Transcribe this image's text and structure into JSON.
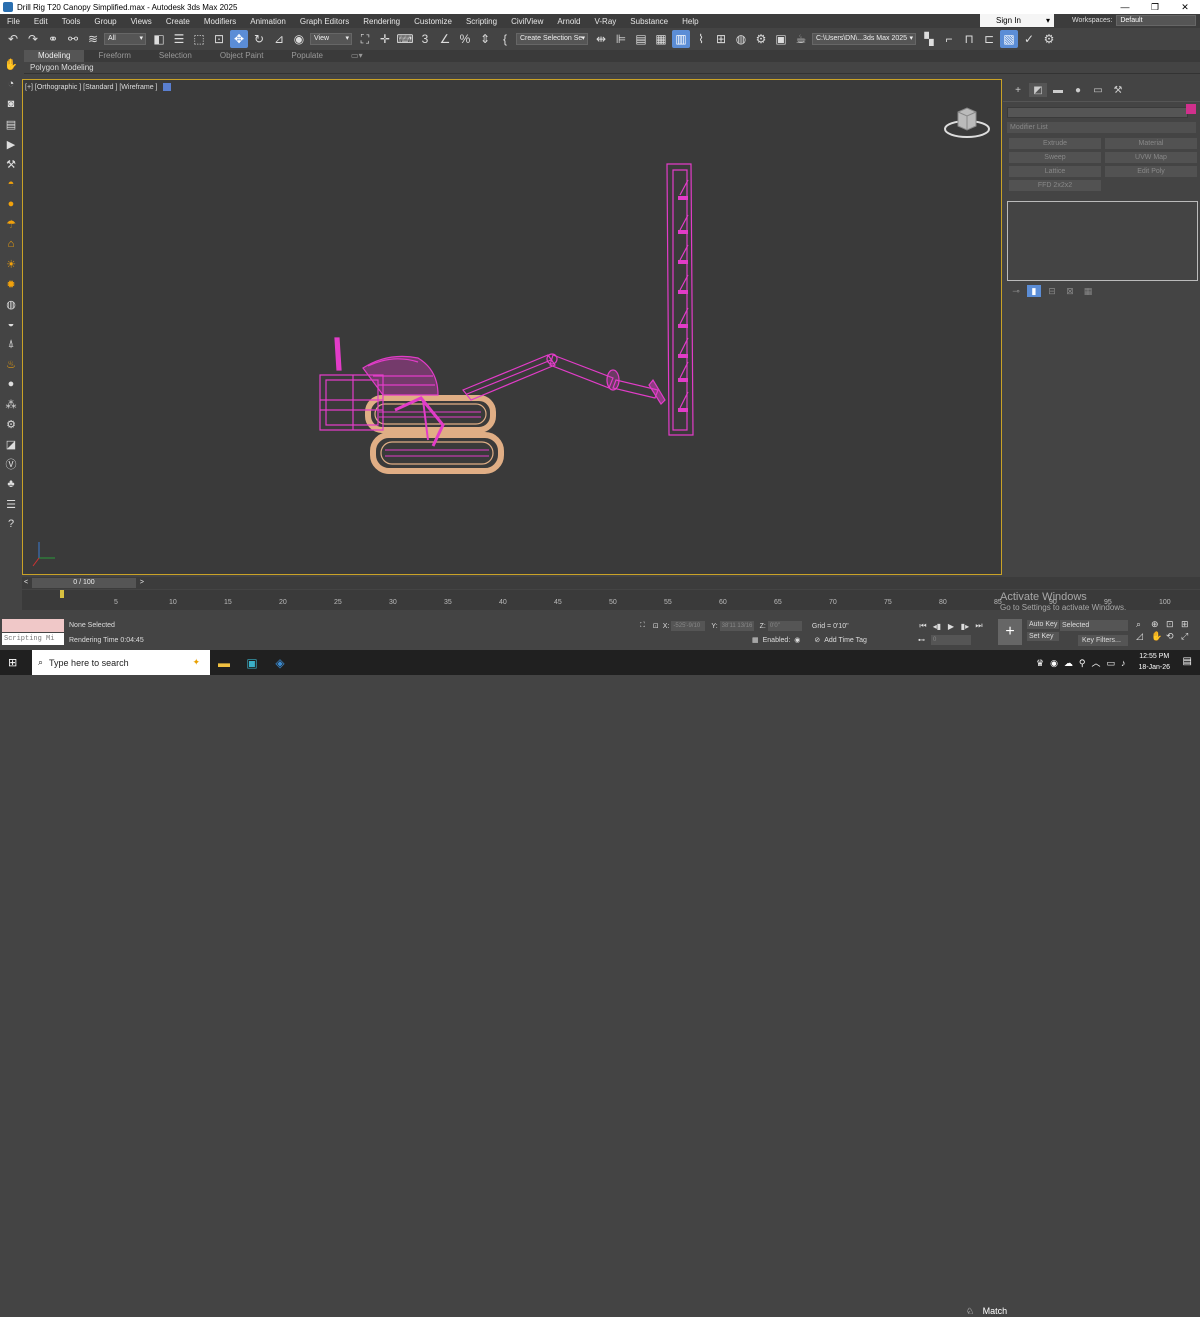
{
  "window": {
    "title": "Drill Rig T20 Canopy Simplified.max - Autodesk 3ds Max 2025",
    "controls": [
      "—",
      "❐",
      "✕"
    ]
  },
  "menu": [
    "File",
    "Edit",
    "Tools",
    "Group",
    "Views",
    "Create",
    "Modifiers",
    "Animation",
    "Graph Editors",
    "Rendering",
    "Customize",
    "Scripting",
    "CivilView",
    "Arnold",
    "V-Ray",
    "Substance",
    "Help"
  ],
  "signin": {
    "label": "Sign In"
  },
  "workspaces": {
    "label": "Workspaces:",
    "value": "Default"
  },
  "toolbar": {
    "filter": "All",
    "ref_coord": "View",
    "selection_set": "Create Selection Se",
    "project_path": "C:\\Users\\DN\\...3ds Max 2025"
  },
  "ribbon": {
    "tabs": [
      "Modeling",
      "Freeform",
      "Selection",
      "Object Paint",
      "Populate"
    ],
    "active": "Modeling",
    "sub": "Polygon Modeling"
  },
  "viewport": {
    "label": "[+] [Orthographic ] [Standard ] [Wireframe ]"
  },
  "command_panel": {
    "modifier_list": "Modifier List",
    "buttons": [
      "Extrude",
      "Material",
      "Sweep",
      "UVW Map",
      "Lattice",
      "Edit Poly",
      "FFD 2x2x2"
    ]
  },
  "timeline": {
    "slider": "0 / 100",
    "ticks": [
      "0",
      "5",
      "10",
      "15",
      "20",
      "25",
      "30",
      "35",
      "40",
      "45",
      "50",
      "55",
      "60",
      "65",
      "70",
      "75",
      "80",
      "85",
      "90",
      "95",
      "100"
    ]
  },
  "status": {
    "script_line": "Scripting Mi",
    "selection": "None Selected",
    "render_time": "Rendering Time  0:04:45",
    "x_label": "X:",
    "x_value": "-525'-9/10",
    "y_label": "Y:",
    "y_value": "38'11 13/16",
    "z_label": "Z:",
    "z_value": "0'0\"",
    "grid": "Grid = 0'10\"",
    "enabled": "Enabled:",
    "add_time_tag": "Add Time Tag",
    "frame": "0",
    "auto_key": "Auto Key",
    "set_key": "Set Key",
    "key_selected": "Selected",
    "key_filters": "Key Filters..."
  },
  "watermark": {
    "line1": "Activate Windows",
    "line2": "Go to Settings to activate Windows."
  },
  "taskbar": {
    "search_placeholder": "Type here to search",
    "tray_label": "Match",
    "time": "12:55 PM",
    "date": "18-Jan-26"
  },
  "colors": {
    "accent": "#5b8dd6",
    "wire_pink": "#e23cc8",
    "wire_orange": "#e0ae85",
    "viewport_border": "#c9a227"
  }
}
